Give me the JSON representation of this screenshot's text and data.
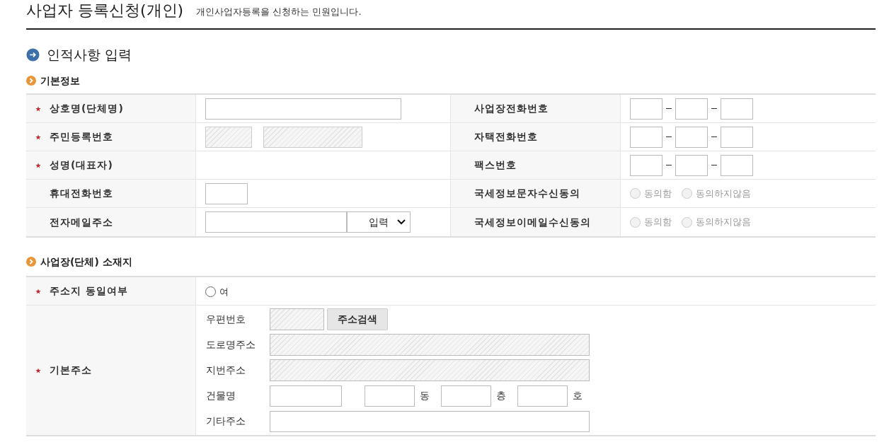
{
  "header": {
    "title": "사업자 등록신청(개인)",
    "description": "개인사업자등록을 신청하는 민원입니다."
  },
  "section": {
    "title": "인적사항 입력"
  },
  "basic_info": {
    "title": "기본정보",
    "rows": [
      {
        "left": {
          "label": "상호명(단체명)",
          "required": true,
          "kind": "text"
        },
        "right": {
          "label": "사업장전화번호",
          "kind": "phone"
        }
      },
      {
        "left": {
          "label": "주민등록번호",
          "required": true,
          "kind": "split"
        },
        "right": {
          "label": "자택전화번호",
          "kind": "phone"
        }
      },
      {
        "left": {
          "label": "성명(대표자)",
          "required": true,
          "kind": "blank"
        },
        "right": {
          "label": "팩스번호",
          "kind": "phone"
        }
      },
      {
        "left": {
          "label": "휴대전화번호",
          "required": false,
          "kind": "short"
        },
        "right": {
          "label": "국세정보문자수신동의",
          "kind": "consent",
          "disabled": true,
          "options": [
            {
              "label": "동의함",
              "selected": false
            },
            {
              "label": "동의하지않음",
              "selected": false
            }
          ]
        }
      },
      {
        "left": {
          "label": "전자메일주소",
          "required": false,
          "kind": "select",
          "value": "입력"
        },
        "right": {
          "label": "국세정보이메일수신동의",
          "kind": "consent",
          "disabled": true,
          "options": [
            {
              "label": "동의함",
              "selected": false
            },
            {
              "label": "동의하지않음",
              "selected": false
            }
          ]
        }
      }
    ]
  },
  "address": {
    "title": "사업장(단체) 소재지",
    "same_address": {
      "label": "주소지 동일여부",
      "required": true,
      "options": [
        {
          "label": "여",
          "selected": false
        }
      ]
    },
    "base_address": {
      "label": "기본주소",
      "required": true,
      "rows": [
        {
          "label": "우편번호",
          "kind": "postcode",
          "button": "주소검색"
        },
        {
          "label": "도로명주소",
          "kind": "readonly"
        },
        {
          "label": "지번주소",
          "kind": "readonly"
        },
        {
          "label": "건물명",
          "kind": "building",
          "units": [
            "동",
            "층",
            "호"
          ]
        },
        {
          "label": "기타주소",
          "kind": "text"
        }
      ]
    }
  }
}
